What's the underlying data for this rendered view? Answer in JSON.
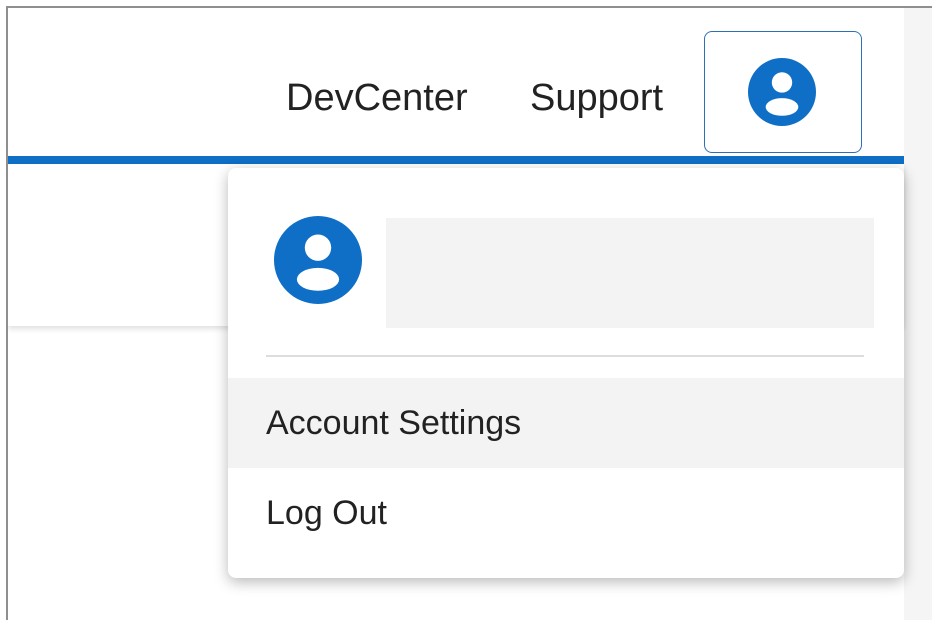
{
  "header": {
    "nav": {
      "devcenter_label": "DevCenter",
      "support_label": "Support"
    },
    "account_button": {
      "icon": "user-circle-icon"
    }
  },
  "dropdown": {
    "profile": {
      "icon": "user-circle-icon",
      "name": ""
    },
    "menu": {
      "account_settings_label": "Account Settings",
      "logout_label": "Log Out"
    }
  },
  "colors": {
    "accent": "#0f6fc6",
    "highlight": "#f3f3f3",
    "text": "#222222",
    "button_border": "#2d6fb7"
  }
}
